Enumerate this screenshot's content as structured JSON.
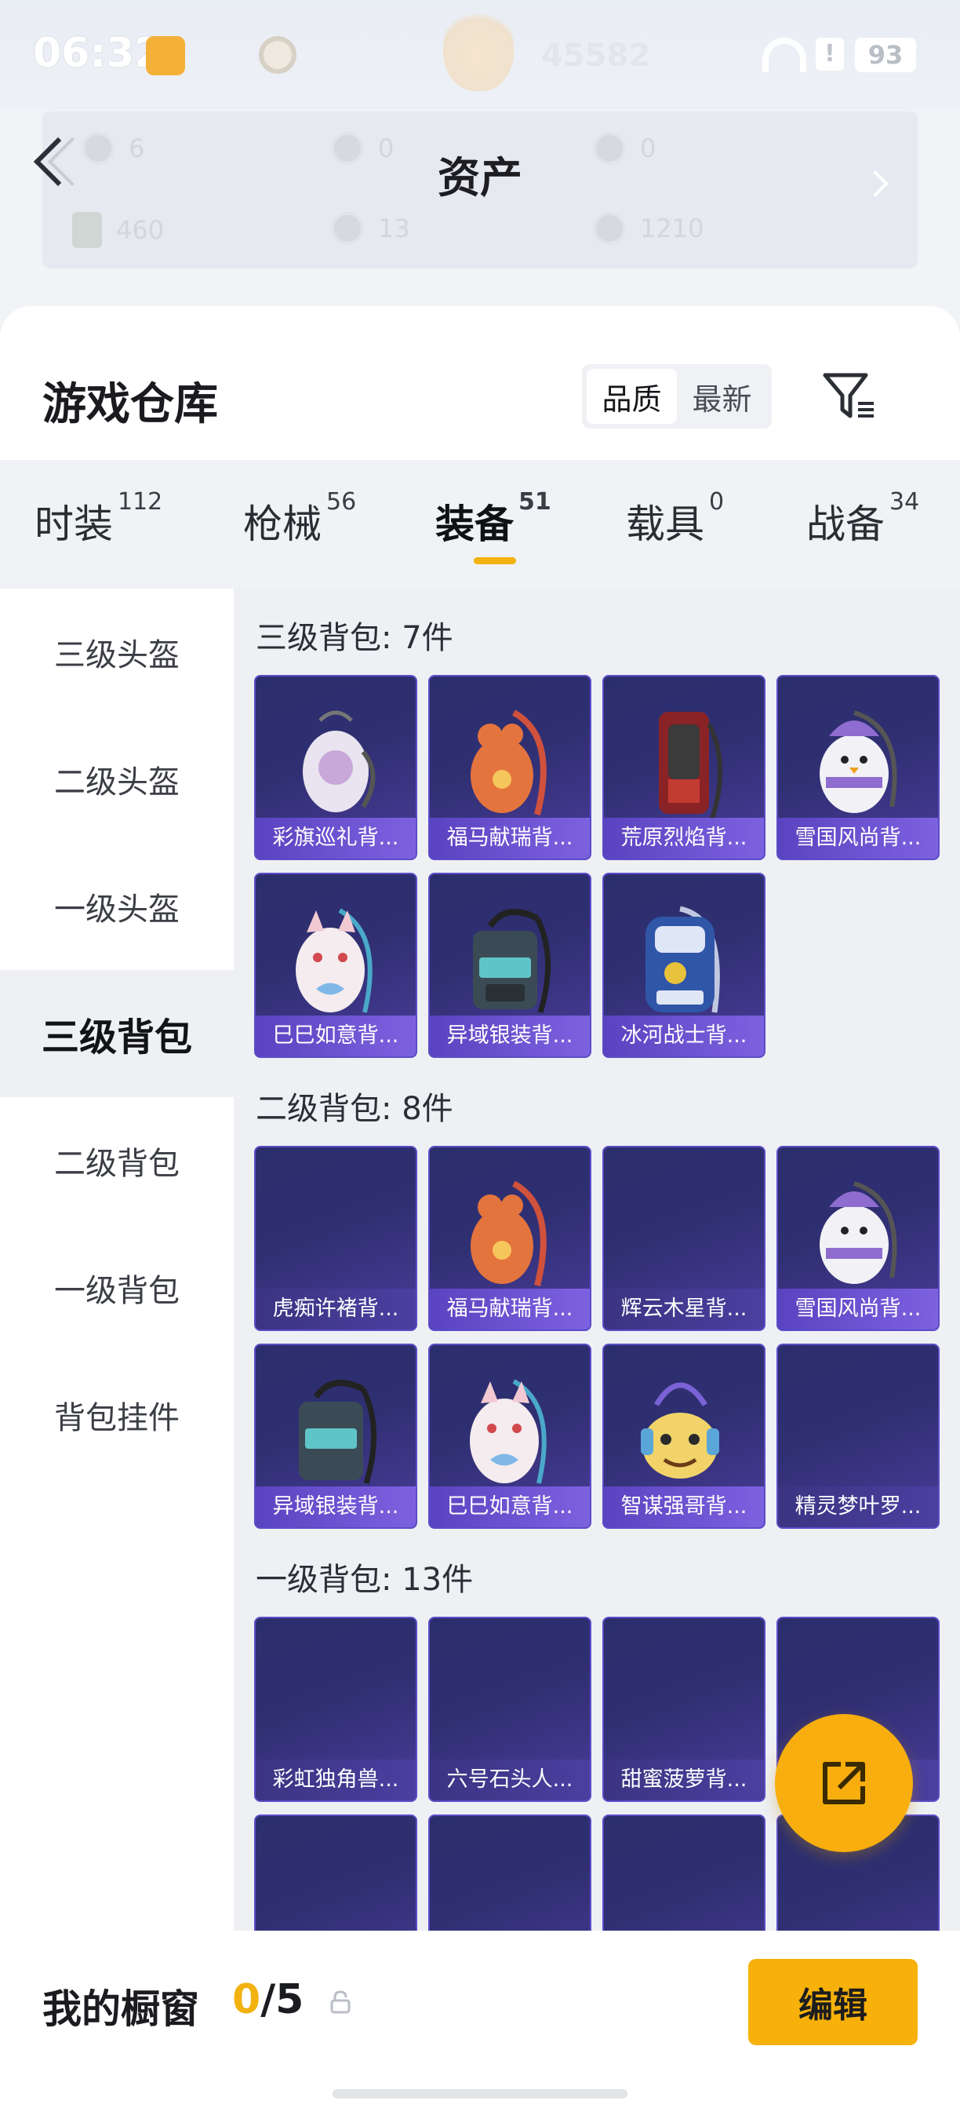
{
  "status_bar": {
    "time": "06:32",
    "ghost_number": "45582",
    "battery": "93"
  },
  "assets": {
    "title": "资产",
    "items": [
      {
        "icon": "coin-icon",
        "value": "6"
      },
      {
        "icon": "coin-icon",
        "value": "0"
      },
      {
        "icon": "coin-icon",
        "value": "0"
      },
      {
        "icon": "card-icon",
        "value": "460"
      },
      {
        "icon": "coin-icon",
        "value": "13"
      },
      {
        "icon": "coin-icon",
        "value": "1210"
      }
    ]
  },
  "warehouse": {
    "title": "游戏仓库",
    "sort": {
      "quality": "品质",
      "latest": "最新",
      "selected": "品质"
    }
  },
  "categories": [
    {
      "label": "时装",
      "count": "112"
    },
    {
      "label": "枪械",
      "count": "56"
    },
    {
      "label": "装备",
      "count": "51",
      "active": true
    },
    {
      "label": "载具",
      "count": "0"
    },
    {
      "label": "战备",
      "count": "34"
    }
  ],
  "sidebar": [
    {
      "label": "三级头盔"
    },
    {
      "label": "二级头盔"
    },
    {
      "label": "一级头盔"
    },
    {
      "label": "三级背包",
      "active": true
    },
    {
      "label": "二级背包"
    },
    {
      "label": "一级背包"
    },
    {
      "label": "背包挂件"
    }
  ],
  "sections": [
    {
      "title": "三级背包: 7件",
      "items": [
        "彩旗巡礼背...",
        "福马献瑞背...",
        "荒原烈焰背...",
        "雪国风尚背...",
        "巳巳如意背...",
        "异域银装背...",
        "冰河战士背..."
      ]
    },
    {
      "title": "二级背包: 8件",
      "items": [
        "虎痴许褚背...",
        "福马献瑞背...",
        "辉云木星背...",
        "雪国风尚背...",
        "异域银装背...",
        "巳巳如意背...",
        "智谋强哥背...",
        "精灵梦叶罗..."
      ]
    },
    {
      "title": "一级背包: 13件",
      "items": [
        "彩虹独角兽...",
        "六号石头人...",
        "甜蜜菠萝背...",
        ""
      ]
    }
  ],
  "showcase": {
    "label": "我的橱窗",
    "used": "0",
    "total": "/5",
    "edit": "编辑"
  },
  "colors": {
    "accent": "#f3b20f",
    "tile_bg": "#2f2f72",
    "tile_caption": "#6a52d4"
  }
}
